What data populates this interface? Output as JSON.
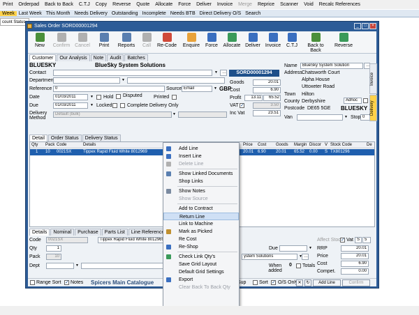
{
  "bg_toolbar": {
    "items": [
      {
        "label": "Print",
        "enabled": true
      },
      {
        "label": "Orderpad",
        "enabled": true
      },
      {
        "label": "Back to Back",
        "enabled": true
      },
      {
        "label": "C.T.J",
        "enabled": true
      },
      {
        "label": "Copy",
        "enabled": true
      },
      {
        "label": "Reverse",
        "enabled": true
      },
      {
        "label": "Quote",
        "enabled": true
      },
      {
        "label": "Allocate",
        "enabled": true
      },
      {
        "label": "Force",
        "enabled": true
      },
      {
        "label": "Deliver",
        "enabled": true
      },
      {
        "label": "Invoice",
        "enabled": true
      },
      {
        "label": "Merge",
        "enabled": false
      },
      {
        "label": "Reprice",
        "enabled": true
      },
      {
        "label": "Scanner",
        "enabled": true
      },
      {
        "label": "Void",
        "enabled": true
      },
      {
        "label": "Recalc References",
        "enabled": true
      }
    ]
  },
  "bg_tabs": [
    {
      "label": "Week",
      "active": true
    },
    {
      "label": "Last Week"
    },
    {
      "label": "This Month"
    },
    {
      "label": "Needs Delivery"
    },
    {
      "label": "Outstanding"
    },
    {
      "label": "Incomplete"
    },
    {
      "label": "Needs BTB"
    },
    {
      "label": "Direct Delivery O/S"
    },
    {
      "label": "Search"
    }
  ],
  "bg_strip": "count Status",
  "window": {
    "title": "Sales Order SORD00001294"
  },
  "toolbar": [
    {
      "label": "New",
      "enabled": true,
      "color": "#4a8f3a"
    },
    {
      "label": "Confirm",
      "enabled": false,
      "color": "#b0b0b0"
    },
    {
      "label": "Cancel",
      "enabled": false,
      "color": "#b0b0b0"
    },
    {
      "label": "Print",
      "enabled": true,
      "color": "#5a7fb0"
    },
    {
      "label": "Reports",
      "enabled": true,
      "color": "#5a7fb0"
    },
    {
      "label": "Call",
      "enabled": false,
      "color": "#b0b0b0"
    },
    {
      "label": "Re-Code",
      "enabled": true,
      "color": "#d04a3a"
    },
    {
      "label": "Enquire",
      "enabled": true,
      "color": "#e8a23a"
    },
    {
      "label": "Force",
      "enabled": true,
      "color": "#3a6fc0"
    },
    {
      "label": "Allocate",
      "enabled": true,
      "color": "#3a9a5a"
    },
    {
      "label": "Deliver",
      "enabled": true,
      "color": "#3a6fc0"
    },
    {
      "label": "Invoice",
      "enabled": true,
      "color": "#3a6fc0"
    },
    {
      "label": "C.T.J",
      "enabled": true,
      "color": "#3a6fc0"
    },
    {
      "label": "Back to Back",
      "enabled": true,
      "color": "#4a8f3a"
    },
    {
      "label": "Reverse",
      "enabled": true,
      "color": "#3a9a5a"
    }
  ],
  "tabs1": [
    {
      "label": "Customer",
      "active": true
    },
    {
      "label": "Our Analysis"
    },
    {
      "label": "Note"
    },
    {
      "label": "Audit"
    },
    {
      "label": "Batches"
    }
  ],
  "header": {
    "account_code": "BLUESKY",
    "account_name": "BlueSky System Solutions",
    "order_number": "SORD00001294",
    "labels": {
      "contact": "Contact",
      "department": "Department",
      "reference": "Reference",
      "source": "Source",
      "date": "Date",
      "due": "Due",
      "delivery_method": "Delivery Method",
      "hold": "Hold",
      "disputed": "Disputed",
      "printed": "Printed",
      "locked": "Locked",
      "complete_delivery": "Complete Delivery Only",
      "goods": "Goods",
      "cost": "Cost",
      "profit": "Profit",
      "vat": "VAT",
      "inc_vat": "Inc Vat",
      "name": "Name",
      "address": "Address",
      "town": "Town",
      "county": "County",
      "postcode": "Postcode",
      "van": "Van",
      "stop": "Stop",
      "adhoc": "Adhoc"
    },
    "reference": "0",
    "source": "Email",
    "currency": "GBP",
    "date": "01/03/2011",
    "due": "01/03/2011",
    "delivery_method": "Default (bulk)",
    "goods": "20.01",
    "cost": "6.90",
    "profit": "13.11",
    "profit_pct": "65.52",
    "vat": "3.50",
    "inc_vat": "23.51",
    "name_value": "BlueSky System Solution",
    "address": [
      "Chatsworth Court",
      "Alpha House",
      "Uttoxeter Road"
    ],
    "town": "Hilton",
    "county": "Derbyshire",
    "postcode": "DE65 5GE",
    "delivery_code": "BLUESKY",
    "stop": "0",
    "side_tabs": [
      "Invoice",
      "Delivery"
    ]
  },
  "tabs2": [
    {
      "label": "Detail",
      "active": true
    },
    {
      "label": "Order Status"
    },
    {
      "label": "Delivery Status"
    }
  ],
  "grid": {
    "columns": [
      "Qty",
      "Pack",
      "Code",
      "Details",
      "RRP",
      "C.",
      "Price",
      "Cost",
      "Goods",
      "Margin",
      "Discor",
      "V",
      "Stock Code",
      "De"
    ],
    "rows": [
      {
        "qty": "1",
        "pack": "10",
        "code": "0021SX",
        "details": "Tippex Rapid Fluid White 8012969",
        "rrp": "20.01",
        "c": "",
        "price": "20.01",
        "cost": "6.90",
        "goods": "20.01",
        "margin": "65.52",
        "discount": "0.00",
        "v": "S",
        "stock_code": "TX801296",
        "de": ""
      }
    ]
  },
  "context_menu": {
    "items": [
      {
        "label": "Add Line",
        "enabled": true,
        "icon": "add-line-icon",
        "color": "#3a6fc0"
      },
      {
        "label": "Insert Line",
        "enabled": true,
        "icon": "insert-line-icon",
        "color": "#3a6fc0"
      },
      {
        "label": "Delete Line",
        "enabled": false,
        "icon": "delete-line-icon",
        "color": "#b0b0b0"
      },
      {
        "sep": true
      },
      {
        "label": "Show Linked Documents",
        "enabled": true,
        "icon": "linked-documents-icon",
        "color": "#5a7fb0"
      },
      {
        "label": "Shop Links",
        "enabled": true,
        "icon": "",
        "color": ""
      },
      {
        "sep": true
      },
      {
        "label": "Show Notes",
        "enabled": true,
        "icon": "notes-icon",
        "color": "#7a8aa0"
      },
      {
        "label": "Show Source",
        "enabled": false,
        "icon": "",
        "color": ""
      },
      {
        "sep": true
      },
      {
        "label": "Add to Contract",
        "enabled": true,
        "icon": "",
        "color": ""
      },
      {
        "label": "Return Line",
        "enabled": true,
        "icon": "",
        "color": "",
        "highlighted": true
      },
      {
        "label": "Link to Machine",
        "enabled": true,
        "icon": "",
        "color": ""
      },
      {
        "label": "Mark as Picked",
        "enabled": true,
        "icon": "mark-picked-icon",
        "color": "#c09030"
      },
      {
        "label": "Re Cost",
        "enabled": true,
        "icon": "",
        "color": ""
      },
      {
        "label": "Re-Shop",
        "enabled": true,
        "icon": "reshop-icon",
        "color": "#3a6fc0"
      },
      {
        "sep": true
      },
      {
        "label": "Check Link Qty's",
        "enabled": true,
        "icon": "check-link-icon",
        "color": "#3a9a5a"
      },
      {
        "label": "Save Grid Layout",
        "enabled": true,
        "icon": "",
        "color": ""
      },
      {
        "label": "Default Grid Settings",
        "enabled": true,
        "icon": "",
        "color": ""
      },
      {
        "label": "Export",
        "enabled": true,
        "icon": "export-icon",
        "color": "#3a6fc0"
      },
      {
        "label": "Clear Back To Back Qty",
        "enabled": false,
        "icon": "",
        "color": ""
      }
    ]
  },
  "tabs3": [
    {
      "label": "Details",
      "active": true
    },
    {
      "label": "Nominal"
    },
    {
      "label": "Purchase"
    },
    {
      "label": "Parts List"
    },
    {
      "label": "Line References"
    },
    {
      "label": "Notes"
    },
    {
      "label": "H"
    }
  ],
  "detail": {
    "labels": {
      "code": "Code",
      "qty": "Qty",
      "pack": "Pack",
      "dept": "Dept",
      "due": "Due",
      "affect_stock": "Affect Stock",
      "vat": "Vat",
      "rrp": "RRP",
      "price": "Price",
      "cost": "Cost",
      "compet": "Compet.",
      "when_added": "When added",
      "totals": "Totals"
    },
    "code": "0021SX",
    "details": "Tippex Rapid Fluid White 8012969",
    "qty": "1",
    "pack": "10",
    "vat": "S",
    "vat_val": "5",
    "supplier": "ystem Solutions",
    "rrp": "20.01",
    "price": "20.01",
    "cost": "6.90",
    "compet": "0.00",
    "when_added_val": "0"
  },
  "bottom": {
    "range_sort": "Range Sort",
    "notes": "Notes",
    "catalogue": "Spicers Main Catalogue",
    "sup": "Sup",
    "sort": "Sort",
    "os_only": "O/S Only",
    "add_line": "Add Line",
    "confirm": "Confirm"
  }
}
